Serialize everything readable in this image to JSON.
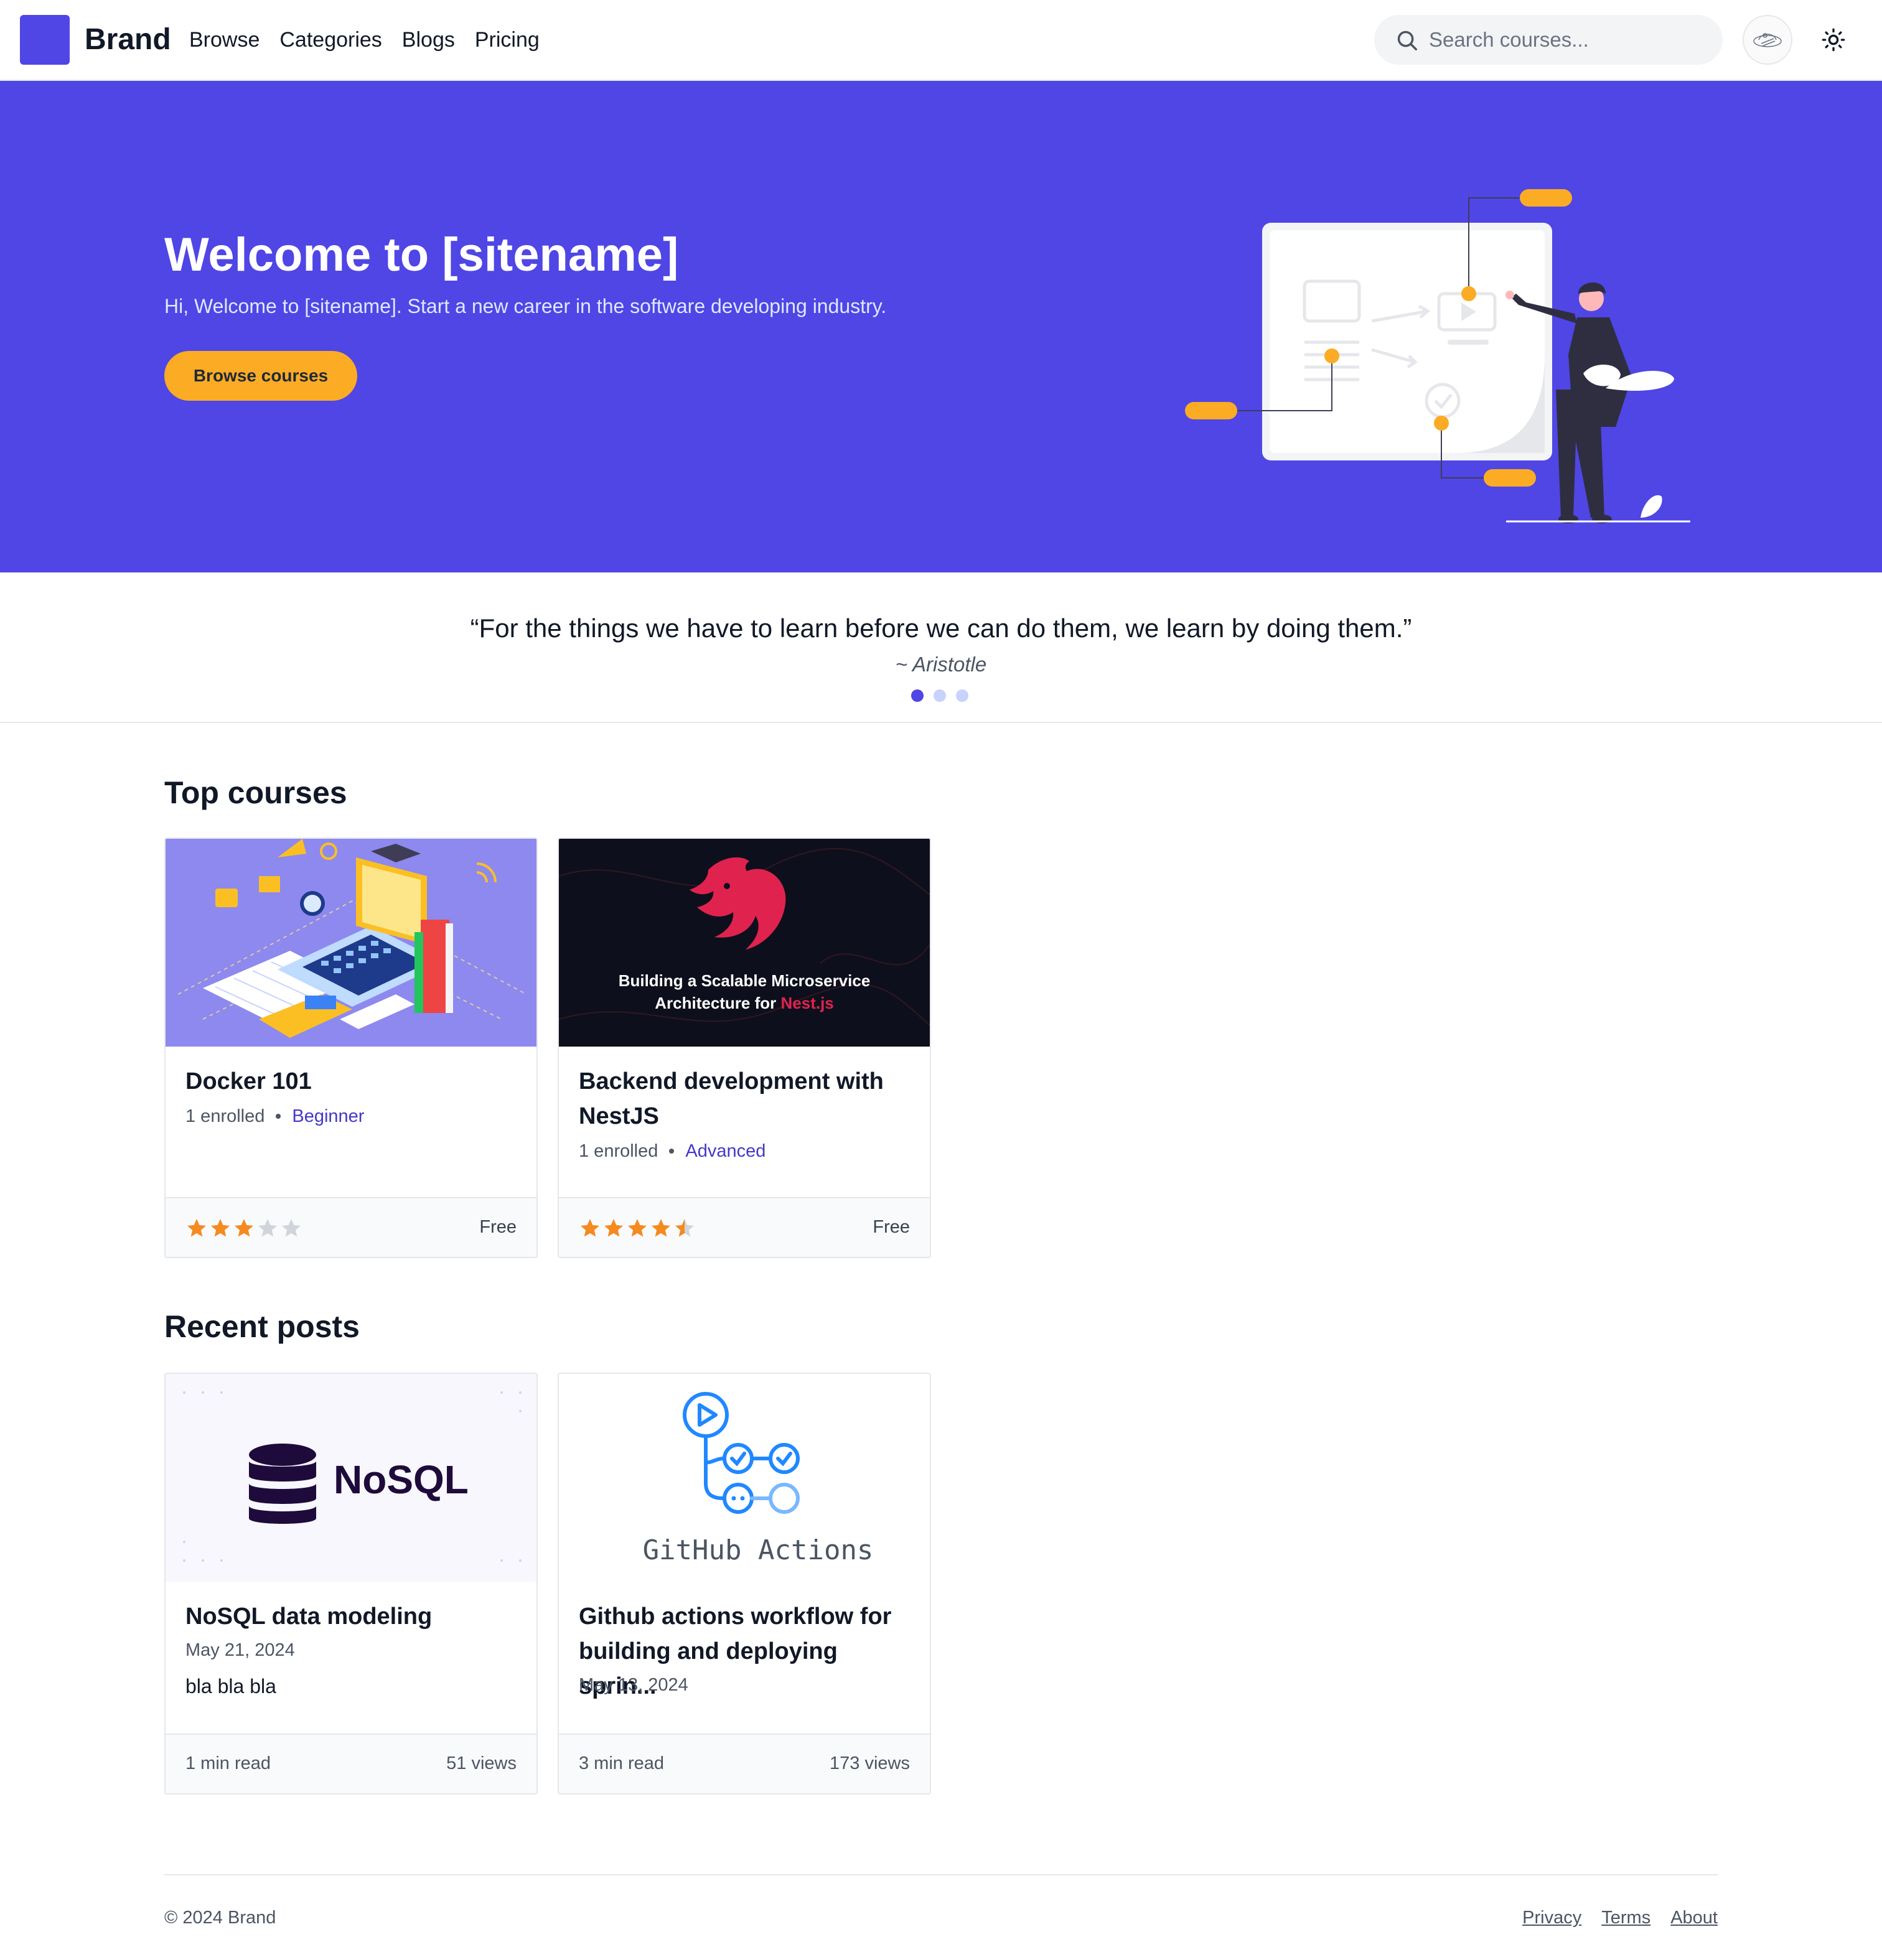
{
  "nav": {
    "brand": "Brand",
    "links": [
      "Browse",
      "Categories",
      "Blogs",
      "Pricing"
    ],
    "search_placeholder": "Search courses..."
  },
  "hero": {
    "title": "Welcome to [sitename]",
    "subtitle": "Hi, Welcome to [sitename]. Start a new career in the software developing industry.",
    "button": "Browse courses"
  },
  "quote": {
    "text": "“For the things we have to learn before we can do them, we learn by doing them.”",
    "author": "~ Aristotle",
    "slides": 3,
    "active_slide": 1
  },
  "top_courses": {
    "title": "Top courses",
    "items": [
      {
        "title": "Docker 101",
        "enrolled": "1 enrolled",
        "level": "Beginner",
        "rating": 3,
        "price": "Free"
      },
      {
        "title": "Backend development with NestJS",
        "enrolled": "1 enrolled",
        "level": "Advanced",
        "rating": 4.5,
        "price": "Free",
        "thumb_line1": "Building a Scalable Microservice",
        "thumb_line2_a": "Architecture for ",
        "thumb_line2_b": "Nest.js"
      }
    ]
  },
  "recent_posts": {
    "title": "Recent posts",
    "items": [
      {
        "title": "NoSQL data modeling",
        "date": "May 21, 2024",
        "excerpt": "bla bla bla",
        "read_time": "1 min read",
        "views": "51 views",
        "thumb_label": "NoSQL"
      },
      {
        "title": "Github actions workflow for building and deploying sprin...",
        "date": "May 13, 2024",
        "excerpt": "",
        "read_time": "3 min read",
        "views": "173 views",
        "thumb_label": "GitHub Actions"
      }
    ]
  },
  "footer": {
    "copyright": "© 2024 Brand",
    "links": [
      "Privacy",
      "Terms",
      "About"
    ]
  },
  "colors": {
    "primary": "#4f46e5",
    "accent": "#fbac24",
    "star": "#f58a1f"
  }
}
